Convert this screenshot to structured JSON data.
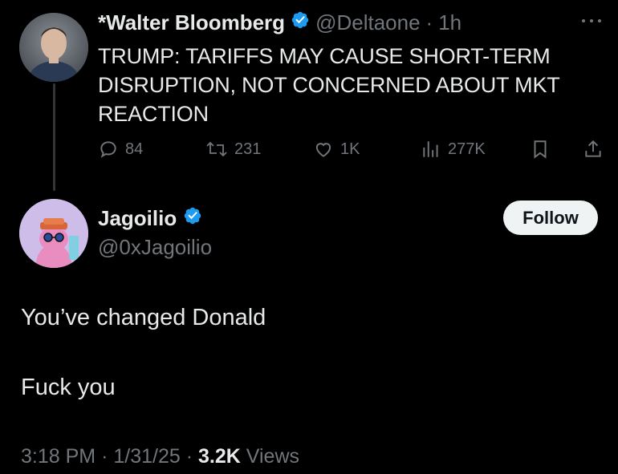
{
  "original_tweet": {
    "author_name": "*Walter Bloomberg",
    "handle": "@Deltaone",
    "separator": "·",
    "time": "1h",
    "text": "TRUMP: TARIFFS MAY CAUSE SHORT-TERM DISRUPTION, NOT CONCERNED ABOUT MKT REACTION",
    "replies": "84",
    "reposts": "231",
    "likes": "1K",
    "views": "277K"
  },
  "reply_tweet": {
    "author_name": "Jagoilio",
    "handle": "@0xJagoilio",
    "follow_label": "Follow",
    "text_line1": "You’ve changed Donald",
    "text_line2": "Fuck you",
    "time": "3:18 PM",
    "sep1": "·",
    "date": "1/31/25",
    "sep2": "·",
    "views_count": "3.2K",
    "views_label": "Views"
  },
  "colors": {
    "background": "#000000",
    "text": "#e7e9ea",
    "muted": "#71767b",
    "verified": "#1d9bf0"
  },
  "icons": [
    "verified-badge-icon",
    "more-icon",
    "reply-icon",
    "repost-icon",
    "like-icon",
    "views-icon",
    "bookmark-icon",
    "share-icon"
  ]
}
